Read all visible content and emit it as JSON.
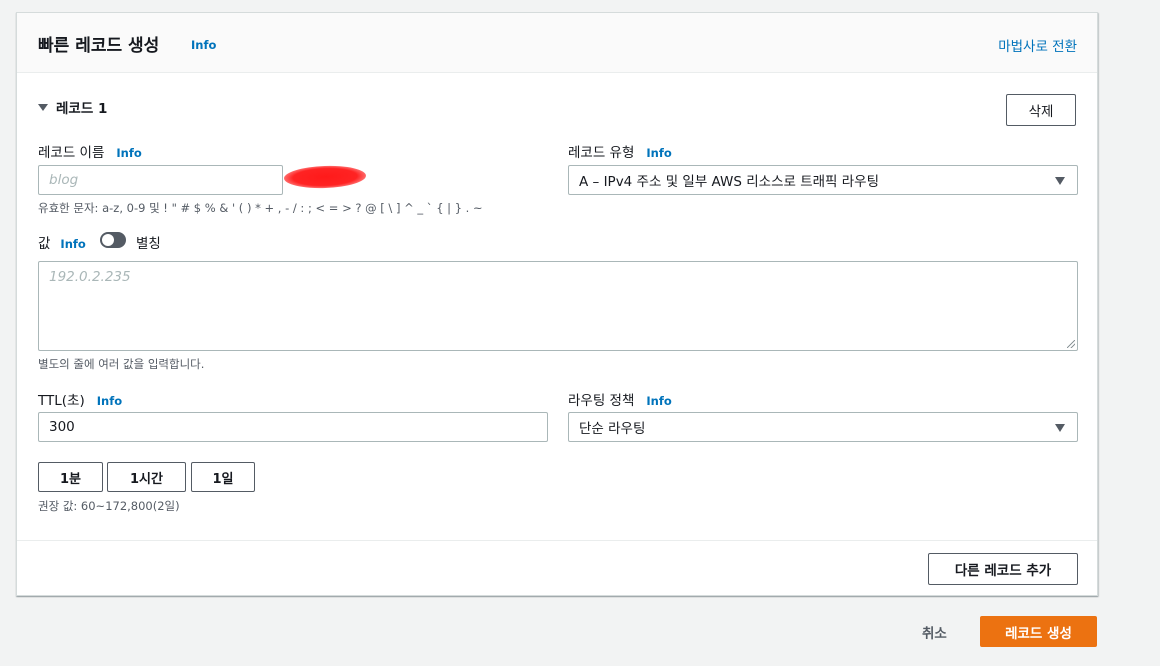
{
  "panel": {
    "title": "빠른 레코드 생성",
    "title_info": "Info",
    "wizard_link": "마법사로 전환"
  },
  "record": {
    "section_title": "레코드 1",
    "delete_label": "삭제",
    "name": {
      "label": "레코드 이름",
      "info": "Info",
      "placeholder": "blog",
      "hint": "유효한 문자: a-z, 0-9 및 ! \" # $ % & ' ( ) * + , - / : ; < = > ? @ [ \\ ] ^ _ ` { | } . ~"
    },
    "type": {
      "label": "레코드 유형",
      "info": "Info",
      "selected": "A – IPv4 주소 및 일부 AWS 리소스로 트래픽 라우팅"
    },
    "value": {
      "label": "값",
      "info": "Info",
      "alias_label": "별칭",
      "alias_enabled": false,
      "placeholder": "192.0.2.235",
      "hint": "별도의 줄에 여러 값을 입력합니다."
    },
    "ttl": {
      "label": "TTL(초)",
      "info": "Info",
      "value": "300",
      "presets": [
        "1분",
        "1시간",
        "1일"
      ],
      "hint": "권장 값: 60~172,800(2일)"
    },
    "routing": {
      "label": "라우팅 정책",
      "info": "Info",
      "selected": "단순 라우팅"
    }
  },
  "footer": {
    "add_record_label": "다른 레코드 추가",
    "cancel_label": "취소",
    "create_label": "레코드 생성"
  },
  "colors": {
    "link": "#0073bb",
    "primary_button": "#ec7211",
    "background": "#f2f3f3",
    "redaction": "#ff1a1a"
  }
}
